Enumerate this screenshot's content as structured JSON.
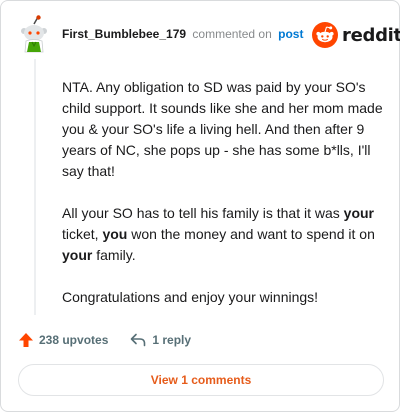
{
  "comment": {
    "username": "First_Bumblebee_179",
    "action_text": "commented on",
    "post_link": "post",
    "paragraphs": [
      [
        {
          "t": "NTA. Any obligation to SD was paid by your SO's child support. It sounds like she and her mom made you & your SO's life a living hell. And then after 9 years of NC, she pops up - she has some b*lls, I'll say that!"
        }
      ],
      [
        {
          "t": "All your SO has to tell his family is that it was "
        },
        {
          "t": "your",
          "b": true
        },
        {
          "t": " ticket, "
        },
        {
          "t": "you",
          "b": true
        },
        {
          "t": " won the money and want to spend it on "
        },
        {
          "t": "your",
          "b": true
        },
        {
          "t": " family."
        }
      ],
      [
        {
          "t": "Congratulations and enjoy your winnings!"
        }
      ]
    ]
  },
  "brand": {
    "wordmark": "reddit",
    "color": "#ff4500"
  },
  "actions": {
    "upvotes_label": "238 upvotes",
    "replies_label": "1 reply"
  },
  "footer": {
    "view_comments_label": "View 1 comments"
  },
  "colors": {
    "accent": "#ff4500",
    "link": "#0079d3",
    "button_text": "#e65c1b"
  },
  "icons": [
    "avatar",
    "reddit-logo-icon",
    "upvote-arrow-icon",
    "reply-arrow-icon"
  ]
}
